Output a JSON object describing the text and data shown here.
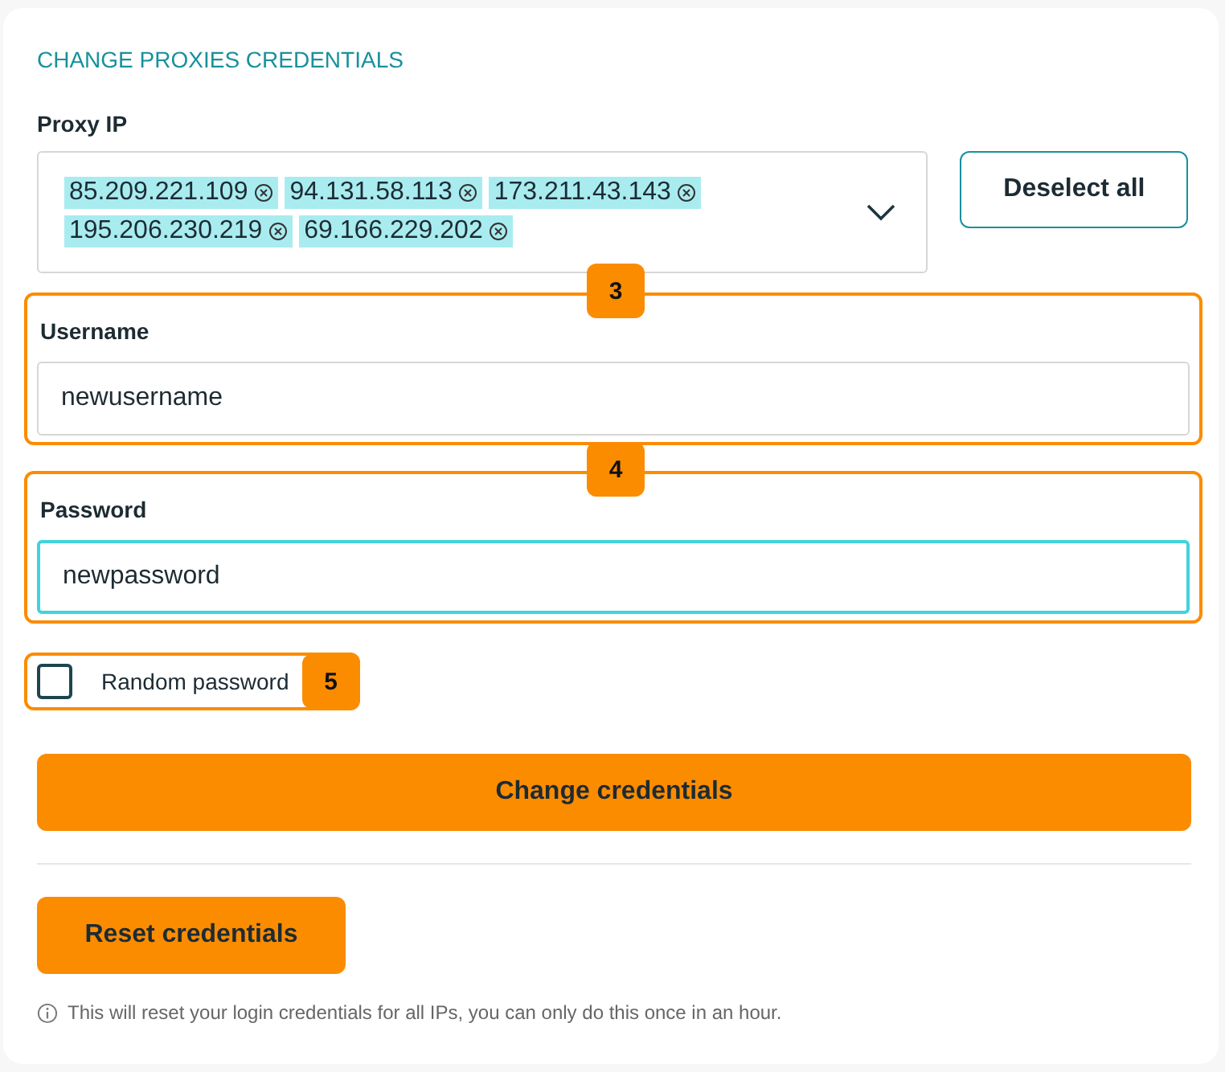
{
  "section_title": "CHANGE PROXIES CREDENTIALS",
  "proxy_ip": {
    "label": "Proxy IP",
    "chips": [
      {
        "text": "85.209.221.109"
      },
      {
        "text": "94.131.58.113"
      },
      {
        "text": "173.211.43.143"
      },
      {
        "text": "195.206.230.219"
      },
      {
        "text": "69.166.229.202"
      }
    ],
    "deselect_button": "Deselect all"
  },
  "fields": [
    {
      "marker": "3",
      "label": "Username",
      "value": "newusername",
      "focused": false
    },
    {
      "marker": "4",
      "label": "Password",
      "value": "newpassword",
      "focused": true
    }
  ],
  "random_password": {
    "label": "Random password",
    "checked": false,
    "marker": "5"
  },
  "change_button": "Change credentials",
  "reset_button": "Reset credentials",
  "info_note": "This will reset your login credentials for all IPs, you can only do this once in an hour."
}
